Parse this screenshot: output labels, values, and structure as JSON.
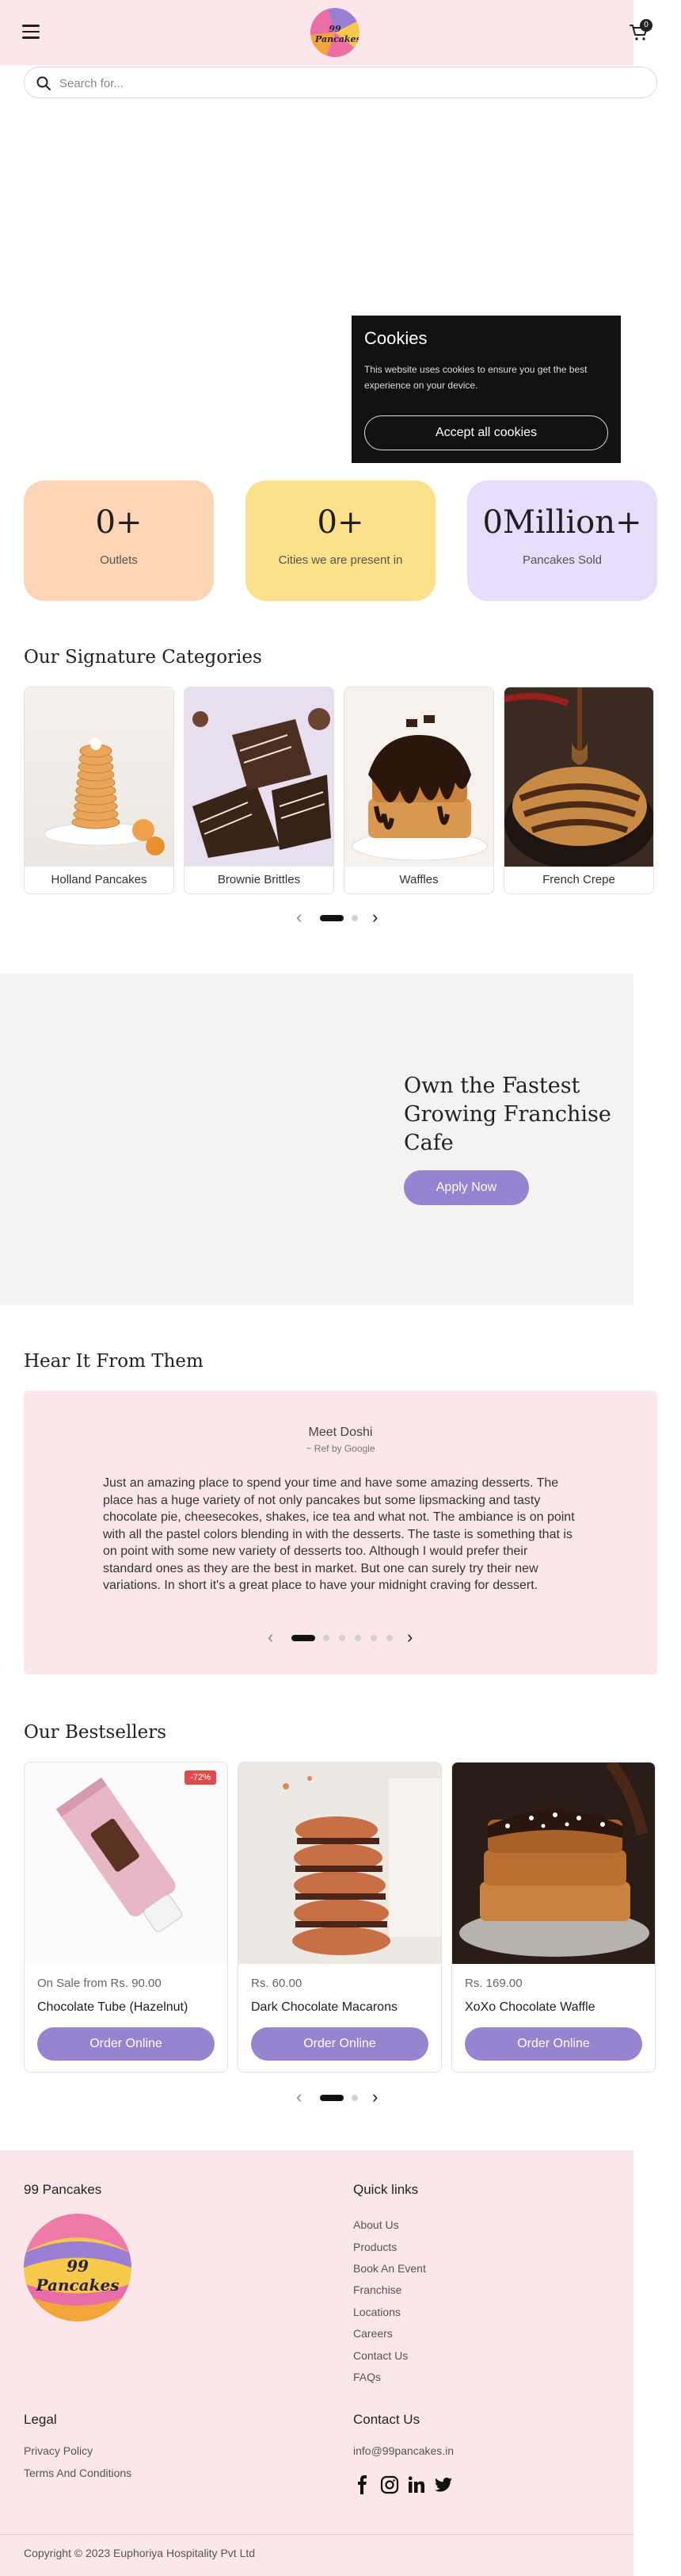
{
  "header": {
    "logo_text": "99 Pancakes",
    "cart_count": "0"
  },
  "search": {
    "placeholder": "Search for..."
  },
  "cookie": {
    "title": "Cookies",
    "text": "This website uses cookies to ensure you get the best experience on your device.",
    "accept_label": "Accept all cookies"
  },
  "stats": [
    {
      "value": "0+",
      "label": "Outlets",
      "color": "#fdd5b4"
    },
    {
      "value": "0+",
      "label": "Cities we are present in",
      "color": "#fde08a"
    },
    {
      "value": "0Million+",
      "label": "Pancakes Sold",
      "color": "#e6ddfb"
    }
  ],
  "categories": {
    "title": "Our Signature Categories",
    "items": [
      {
        "label": "Holland Pancakes"
      },
      {
        "label": "Brownie Brittles"
      },
      {
        "label": "Waffles"
      },
      {
        "label": "French Crepe"
      }
    ]
  },
  "franchise": {
    "title": "Own the Fastest Growing Franchise Cafe",
    "button_label": "Apply Now"
  },
  "testimonials": {
    "title": "Hear It From Them",
    "name": "Meet Doshi",
    "ref": "~ Ref by Google",
    "quote": "Just an amazing place to spend your time and have some amazing desserts. The place has a huge variety of not only pancakes but some lipsmacking and tasty chocolate pie, cheesecokes, shakes, ice tea and what not. The ambiance is on point with all the pastel colors blending in with the desserts. The taste is something that is on point with some new variety of desserts too. Although I would prefer their standard ones as they are the best in market. But one can surely try their new variations. In short it's a great place to have your midnight craving for dessert."
  },
  "bestsellers": {
    "title": "Our Bestsellers",
    "items": [
      {
        "price": "On Sale from Rs. 90.00",
        "name": "Chocolate Tube (Hazelnut)",
        "badge": "-72%",
        "button_label": "Order Online"
      },
      {
        "price": "Rs. 60.00",
        "name": "Dark Chocolate Macarons",
        "badge": "",
        "button_label": "Order Online"
      },
      {
        "price": "Rs. 169.00",
        "name": "XoXo Chocolate Waffle",
        "badge": "",
        "button_label": "Order Online"
      }
    ]
  },
  "footer": {
    "brand": "99 Pancakes",
    "logo_text": "99 Pancakes",
    "quick_links_title": "Quick links",
    "quick_links": [
      "About Us",
      "Products",
      "Book An Event",
      "Franchise",
      "Locations",
      "Careers",
      "Contact Us",
      "FAQs"
    ],
    "legal_title": "Legal",
    "legal_links": [
      "Privacy Policy",
      "Terms And Conditions"
    ],
    "contact_title": "Contact Us",
    "email": "info@99pancakes.in",
    "social_icons": [
      "facebook-icon",
      "instagram-icon",
      "linkedin-icon",
      "twitter-icon"
    ],
    "copyright": "Copyright © 2023 Euphoriya Hospitality Pvt Ltd"
  },
  "colors": {
    "accent": "#9784d0",
    "header_bg": "#fbe7ea"
  }
}
